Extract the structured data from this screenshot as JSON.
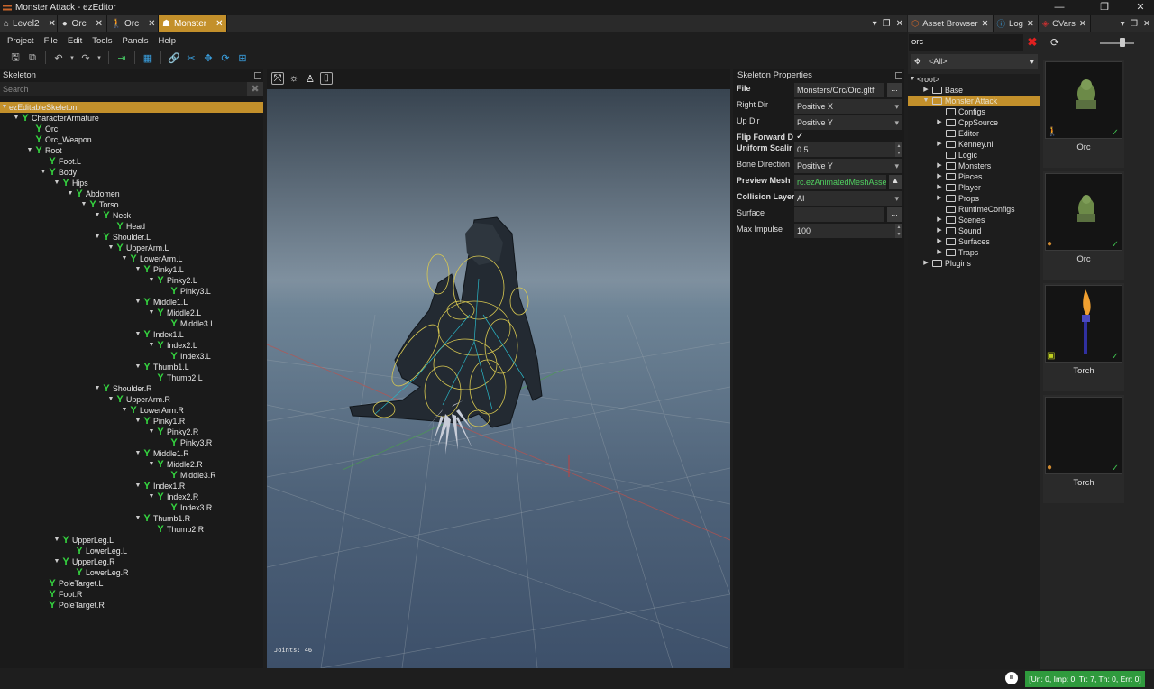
{
  "window": {
    "title": "Monster Attack - ezEditor"
  },
  "doc_tabs": [
    {
      "label": "Level2",
      "icon": "level-icon"
    },
    {
      "label": "Orc",
      "icon": "mesh-icon"
    },
    {
      "label": "Orc",
      "icon": "character-icon"
    },
    {
      "label": "Monster",
      "icon": "skeleton-icon",
      "active": true
    }
  ],
  "menu": [
    "Project",
    "File",
    "Edit",
    "Tools",
    "Panels",
    "Help"
  ],
  "skeleton_panel": {
    "title": "Skeleton",
    "search_placeholder": "Search",
    "tree": [
      {
        "label": "ezEditableSkeleton",
        "depth": 0,
        "expanded": true,
        "bone": false,
        "selected": true
      },
      {
        "label": "CharacterArmature",
        "depth": 1,
        "expanded": true,
        "bone": true
      },
      {
        "label": "Orc",
        "depth": 2,
        "bone": true
      },
      {
        "label": "Orc_Weapon",
        "depth": 2,
        "bone": true
      },
      {
        "label": "Root",
        "depth": 2,
        "expanded": true,
        "bone": true
      },
      {
        "label": "Foot.L",
        "depth": 3,
        "bone": true
      },
      {
        "label": "Body",
        "depth": 3,
        "expanded": true,
        "bone": true
      },
      {
        "label": "Hips",
        "depth": 4,
        "expanded": true,
        "bone": true
      },
      {
        "label": "Abdomen",
        "depth": 5,
        "expanded": true,
        "bone": true
      },
      {
        "label": "Torso",
        "depth": 6,
        "expanded": true,
        "bone": true
      },
      {
        "label": "Neck",
        "depth": 7,
        "expanded": true,
        "bone": true
      },
      {
        "label": "Head",
        "depth": 8,
        "bone": true
      },
      {
        "label": "Shoulder.L",
        "depth": 7,
        "expanded": true,
        "bone": true
      },
      {
        "label": "UpperArm.L",
        "depth": 8,
        "expanded": true,
        "bone": true
      },
      {
        "label": "LowerArm.L",
        "depth": 9,
        "expanded": true,
        "bone": true
      },
      {
        "label": "Pinky1.L",
        "depth": 10,
        "expanded": true,
        "bone": true
      },
      {
        "label": "Pinky2.L",
        "depth": 11,
        "expanded": true,
        "bone": true
      },
      {
        "label": "Pinky3.L",
        "depth": 12,
        "bone": true
      },
      {
        "label": "Middle1.L",
        "depth": 10,
        "expanded": true,
        "bone": true
      },
      {
        "label": "Middle2.L",
        "depth": 11,
        "expanded": true,
        "bone": true
      },
      {
        "label": "Middle3.L",
        "depth": 12,
        "bone": true
      },
      {
        "label": "Index1.L",
        "depth": 10,
        "expanded": true,
        "bone": true
      },
      {
        "label": "Index2.L",
        "depth": 11,
        "expanded": true,
        "bone": true
      },
      {
        "label": "Index3.L",
        "depth": 12,
        "bone": true
      },
      {
        "label": "Thumb1.L",
        "depth": 10,
        "expanded": true,
        "bone": true
      },
      {
        "label": "Thumb2.L",
        "depth": 11,
        "bone": true
      },
      {
        "label": "Shoulder.R",
        "depth": 7,
        "expanded": true,
        "bone": true
      },
      {
        "label": "UpperArm.R",
        "depth": 8,
        "expanded": true,
        "bone": true
      },
      {
        "label": "LowerArm.R",
        "depth": 9,
        "expanded": true,
        "bone": true
      },
      {
        "label": "Pinky1.R",
        "depth": 10,
        "expanded": true,
        "bone": true
      },
      {
        "label": "Pinky2.R",
        "depth": 11,
        "expanded": true,
        "bone": true
      },
      {
        "label": "Pinky3.R",
        "depth": 12,
        "bone": true
      },
      {
        "label": "Middle1.R",
        "depth": 10,
        "expanded": true,
        "bone": true
      },
      {
        "label": "Middle2.R",
        "depth": 11,
        "expanded": true,
        "bone": true
      },
      {
        "label": "Middle3.R",
        "depth": 12,
        "bone": true
      },
      {
        "label": "Index1.R",
        "depth": 10,
        "expanded": true,
        "bone": true
      },
      {
        "label": "Index2.R",
        "depth": 11,
        "expanded": true,
        "bone": true
      },
      {
        "label": "Index3.R",
        "depth": 12,
        "bone": true
      },
      {
        "label": "Thumb1.R",
        "depth": 10,
        "expanded": true,
        "bone": true
      },
      {
        "label": "Thumb2.R",
        "depth": 11,
        "bone": true
      },
      {
        "label": "UpperLeg.L",
        "depth": 4,
        "expanded": true,
        "bone": true
      },
      {
        "label": "LowerLeg.L",
        "depth": 5,
        "bone": true
      },
      {
        "label": "UpperLeg.R",
        "depth": 4,
        "expanded": true,
        "bone": true
      },
      {
        "label": "LowerLeg.R",
        "depth": 5,
        "bone": true
      },
      {
        "label": "PoleTarget.L",
        "depth": 3,
        "bone": true
      },
      {
        "label": "Foot.R",
        "depth": 3,
        "bone": true
      },
      {
        "label": "PoleTarget.R",
        "depth": 3,
        "bone": true
      }
    ]
  },
  "viewport": {
    "joints_text": "Joints: 46"
  },
  "props": {
    "title": "Skeleton Properties",
    "file_label": "File",
    "file_value": "Monsters/Orc/Orc.gltf",
    "right_dir_label": "Right Dir",
    "right_dir_value": "Positive X",
    "up_dir_label": "Up Dir",
    "up_dir_value": "Positive Y",
    "flip_label": "Flip Forward D",
    "flip_value": "✓",
    "scale_label": "Uniform Scalir",
    "scale_value": "0.5",
    "bone_dir_label": "Bone Direction",
    "bone_dir_value": "Positive Y",
    "preview_label": "Preview Mesh",
    "preview_value": "rc.ezAnimatedMeshAsset",
    "collision_label": "Collision Layer",
    "collision_value": "AI",
    "surface_label": "Surface",
    "surface_value": "",
    "impulse_label": "Max Impulse",
    "impulse_value": "100",
    "browse_label": "..."
  },
  "side_tabs": [
    {
      "label": "Asset Browser",
      "icon": "asset-browser-icon",
      "active": true
    },
    {
      "label": "Log",
      "icon": "info-icon"
    },
    {
      "label": "CVars",
      "icon": "cvars-icon"
    }
  ],
  "asset_browser": {
    "search_value": "orc",
    "filter_value": "<All>",
    "tree": [
      {
        "label": "<root>",
        "depth": 0,
        "expanded": true,
        "folder": false
      },
      {
        "label": "Base",
        "depth": 1,
        "expanded": false,
        "folder": true
      },
      {
        "label": "Monster Attack",
        "depth": 1,
        "expanded": true,
        "folder": true,
        "selected": true
      },
      {
        "label": "Configs",
        "depth": 2,
        "folder": true
      },
      {
        "label": "CppSource",
        "depth": 2,
        "expanded": false,
        "folder": true
      },
      {
        "label": "Editor",
        "depth": 2,
        "folder": true
      },
      {
        "label": "Kenney.nl",
        "depth": 2,
        "expanded": false,
        "folder": true
      },
      {
        "label": "Logic",
        "depth": 2,
        "folder": true
      },
      {
        "label": "Monsters",
        "depth": 2,
        "expanded": false,
        "folder": true
      },
      {
        "label": "Pieces",
        "depth": 2,
        "expanded": false,
        "folder": true
      },
      {
        "label": "Player",
        "depth": 2,
        "expanded": false,
        "folder": true
      },
      {
        "label": "Props",
        "depth": 2,
        "expanded": false,
        "folder": true
      },
      {
        "label": "RuntimeConfigs",
        "depth": 2,
        "folder": true
      },
      {
        "label": "Scenes",
        "depth": 2,
        "expanded": false,
        "folder": true
      },
      {
        "label": "Sound",
        "depth": 2,
        "expanded": false,
        "folder": true
      },
      {
        "label": "Surfaces",
        "depth": 2,
        "expanded": false,
        "folder": true
      },
      {
        "label": "Traps",
        "depth": 2,
        "expanded": false,
        "folder": true
      },
      {
        "label": "Plugins",
        "depth": 1,
        "expanded": false,
        "folder": true
      }
    ],
    "assets": [
      {
        "name": "Orc",
        "kind": "character"
      },
      {
        "name": "Orc",
        "kind": "mesh"
      },
      {
        "name": "Torch",
        "kind": "prefab"
      },
      {
        "name": "Torch",
        "kind": "particle"
      }
    ]
  },
  "status": {
    "info": "[Un: 0, Imp: 0, Tr: 7, Th: 0, Err: 0]",
    "pause": "II"
  },
  "colors": {
    "accent": "#c3902b",
    "bone": "#35d640",
    "status_ok": "#2f9a3d"
  }
}
